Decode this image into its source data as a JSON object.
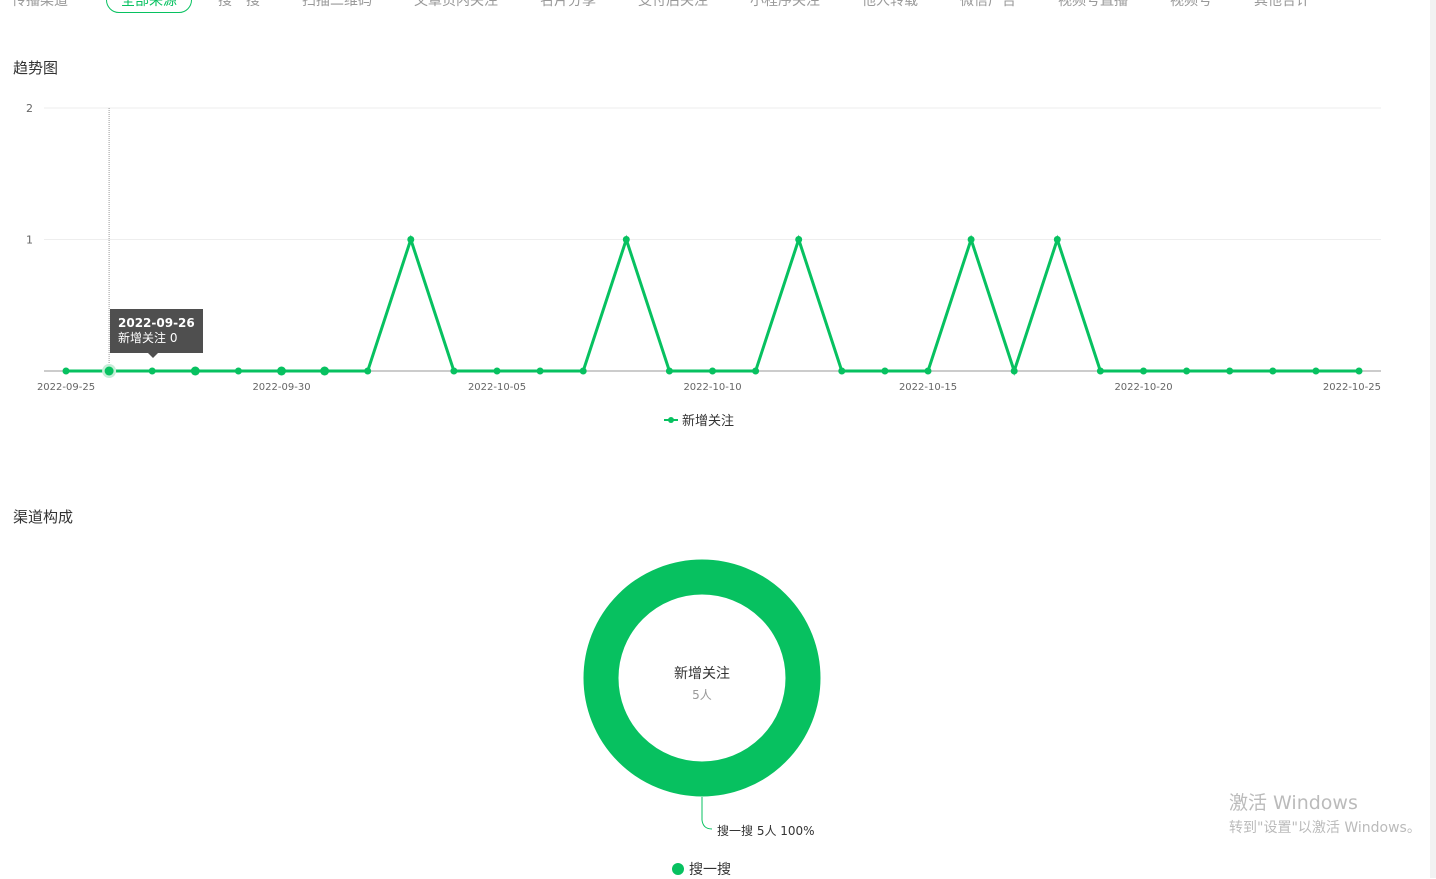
{
  "tabs": {
    "label": "传播渠道",
    "items": [
      "全部来源",
      "搜一搜",
      "扫描二维码",
      "文章页内关注",
      "名片分享",
      "支付后关注",
      "小程序关注",
      "他人转载",
      "微信广告",
      "视频号直播",
      "视频号",
      "其他合计"
    ],
    "active": 0
  },
  "trend": {
    "title": "趋势图",
    "legend": "新增关注",
    "tooltip": {
      "date": "2022-09-26",
      "text": "新增关注 0"
    }
  },
  "chart_data": {
    "type": "line",
    "title": "趋势图",
    "ylim": [
      0,
      2
    ],
    "yticks": [
      1,
      2
    ],
    "xticks": [
      "2022-09-25",
      "2022-09-30",
      "2022-10-05",
      "2022-10-10",
      "2022-10-15",
      "2022-10-20",
      "2022-10-25"
    ],
    "series": [
      {
        "name": "新增关注",
        "color": "#07c160",
        "values": [
          0,
          0,
          0,
          0,
          0,
          0,
          0,
          0,
          1,
          0,
          0,
          0,
          0,
          1,
          0,
          0,
          0,
          1,
          0,
          0,
          0,
          1,
          0,
          1,
          0,
          0,
          0,
          0,
          0,
          0,
          0
        ]
      }
    ]
  },
  "channel": {
    "title": "渠道构成",
    "center_title": "新增关注",
    "center_value": "5人",
    "label": "搜一搜 5人 100%",
    "legend": "搜一搜",
    "color": "#07c160"
  },
  "watermark": {
    "line1": "激活 Windows",
    "line2": "转到\"设置\"以激活 Windows。"
  }
}
